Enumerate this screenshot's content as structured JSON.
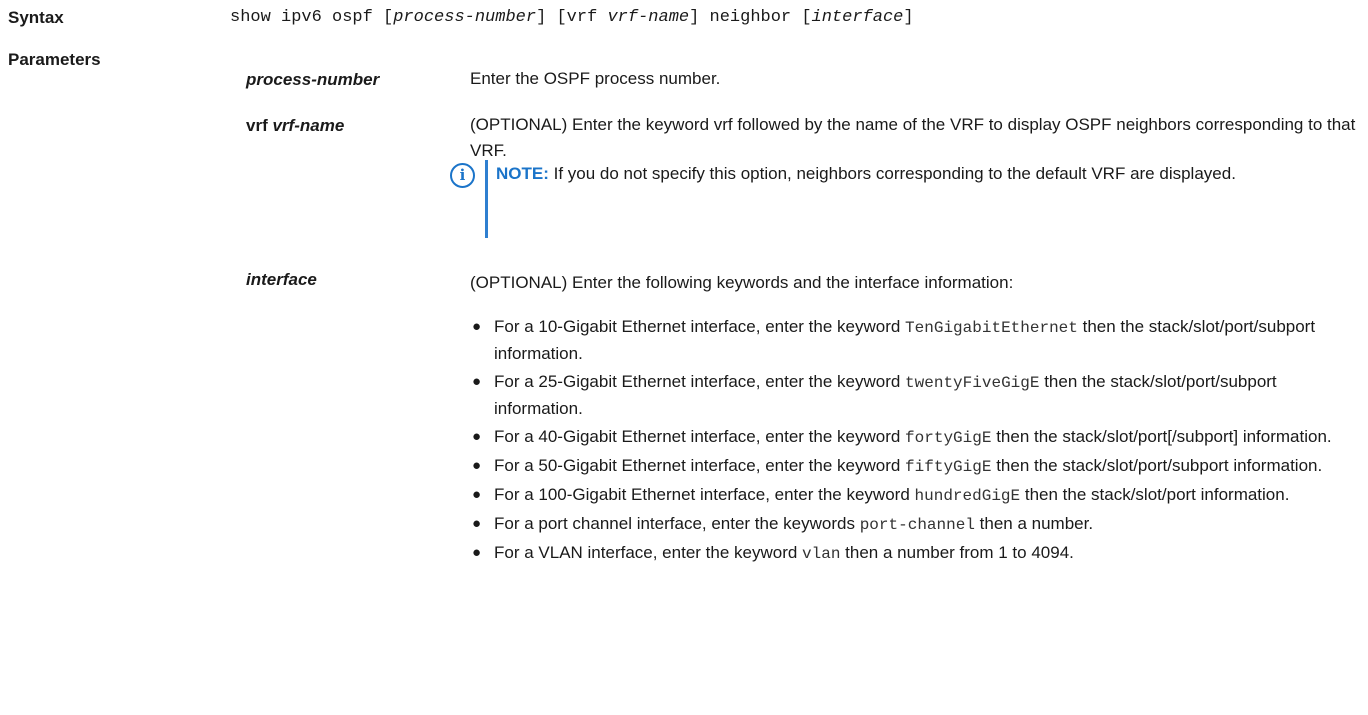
{
  "labels": {
    "syntax": "Syntax",
    "parameters": "Parameters"
  },
  "syntax": {
    "p1": "show ipv6 ospf [",
    "arg1": "process-number",
    "p2": "] [vrf ",
    "arg2": "vrf-name",
    "p3": "] neighbor [",
    "arg3": "interface",
    "p4": "]"
  },
  "params": {
    "process_number": {
      "name": "process-number",
      "desc": "Enter the OSPF process number."
    },
    "vrf": {
      "name_kw": "vrf ",
      "name_arg": "vrf-name",
      "desc": "(OPTIONAL) Enter the keyword vrf followed by the name of the VRF to display OSPF neighbors corresponding to that VRF.",
      "note_label": "NOTE:",
      "note_text": " If you do not specify this option, neighbors corresponding to the default VRF are displayed."
    },
    "interface": {
      "name": "interface",
      "desc": "(OPTIONAL) Enter the following keywords and the interface information:",
      "bullets": [
        {
          "pre": "For a 10-Gigabit Ethernet interface, enter the keyword ",
          "kw": "TenGigabitEthernet",
          "post": " then the stack/slot/port/subport information."
        },
        {
          "pre": "For a 25-Gigabit Ethernet interface, enter the keyword ",
          "kw": "twentyFiveGigE",
          "post": " then the stack/slot/port/subport information."
        },
        {
          "pre": "For a 40-Gigabit Ethernet interface, enter the keyword ",
          "kw": "fortyGigE",
          "post": " then the stack/slot/port[/subport] information."
        },
        {
          "pre": "For a 50-Gigabit Ethernet interface, enter the keyword ",
          "kw": "fiftyGigE",
          "post": " then the stack/slot/port/subport information."
        },
        {
          "pre": "For a 100-Gigabit Ethernet interface, enter the keyword ",
          "kw": "hundredGigE",
          "post": " then the stack/slot/port information."
        },
        {
          "pre": "For a port channel interface, enter the keywords ",
          "kw": "port-channel",
          "post": " then a number."
        },
        {
          "pre": "For a VLAN interface, enter the keyword ",
          "kw": "vlan",
          "post": " then a number from 1 to 4094."
        }
      ]
    }
  },
  "icons": {
    "note": "info-icon",
    "note_glyph": "i",
    "bullet_glyph": "●"
  },
  "colors": {
    "note_accent": "#1b74c9"
  }
}
